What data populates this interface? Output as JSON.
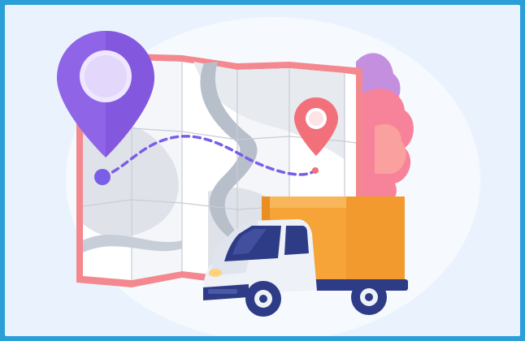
{
  "illustration": {
    "subject": "delivery-route-map",
    "icons": [
      "map-icon",
      "location-pin-icon",
      "destination-pin-icon",
      "route-path-icon",
      "delivery-truck-icon",
      "bush-icon"
    ],
    "colors": {
      "frame_border": "#2a9fd8",
      "panel_background": "#eaf3fd",
      "map_border": "#f3888f",
      "map_paper": "#ffffff",
      "map_land": "#dfe3e9",
      "map_river": "#b7bfcb",
      "pin_primary": "#8f64e6",
      "pin_secondary": "#f1707a",
      "route_line": "#7a5de8",
      "truck_cargo": "#f6a338",
      "truck_cab": "#eef1f7",
      "truck_dark": "#2e3b86",
      "bush_purple": "#c58fe0",
      "bush_pink": "#f7839a"
    }
  }
}
